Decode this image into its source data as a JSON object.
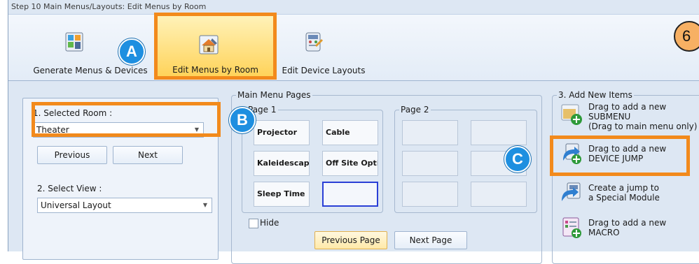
{
  "window": {
    "title": "Step 10 Main Menus/Layouts: Edit Menus by Room"
  },
  "ribbon": {
    "buttons": [
      {
        "label": "Generate Menus & Devices",
        "icon": "generate-menus-icon"
      },
      {
        "label": "Edit Menus by Room",
        "icon": "edit-menus-room-icon",
        "active": true
      },
      {
        "label": "Edit Device Layouts",
        "icon": "edit-device-layouts-icon"
      }
    ]
  },
  "callouts": {
    "a": "A",
    "b": "B",
    "c": "C",
    "six": "6"
  },
  "left_panel": {
    "room_label": "1. Selected Room :",
    "room_value": "Theater",
    "previous_label": "Previous",
    "next_label": "Next",
    "view_label": "2. Select View :",
    "view_value": "Universal Layout"
  },
  "main_menu": {
    "title": "Main Menu Pages",
    "page1_title": "Page 1",
    "page2_title": "Page 2",
    "page1_tiles": [
      "Projector",
      "Cable",
      "Kaleidescape",
      "Off Site Options",
      "Sleep Time",
      ""
    ],
    "hide_label": "Hide",
    "prev_page_label": "Previous Page",
    "next_page_label": "Next Page"
  },
  "add_items": {
    "title": "3. Add New Items",
    "items": [
      {
        "line1": "Drag to add a new",
        "line2": "SUBMENU",
        "line3": "(Drag to main menu only)",
        "icon": "submenu-add-icon"
      },
      {
        "line1": "Drag to add a new",
        "line2": "DEVICE JUMP",
        "icon": "device-jump-add-icon"
      },
      {
        "line1": "Create a jump to",
        "line2": "a Special Module",
        "icon": "special-module-jump-icon"
      },
      {
        "line1": "Drag to add a new",
        "line2": "MACRO",
        "icon": "macro-add-icon"
      }
    ]
  },
  "colors": {
    "accent_orange": "#f28a1c",
    "callout_blue": "#1e8fe0",
    "selected_tile_border": "#2a3fd6"
  }
}
